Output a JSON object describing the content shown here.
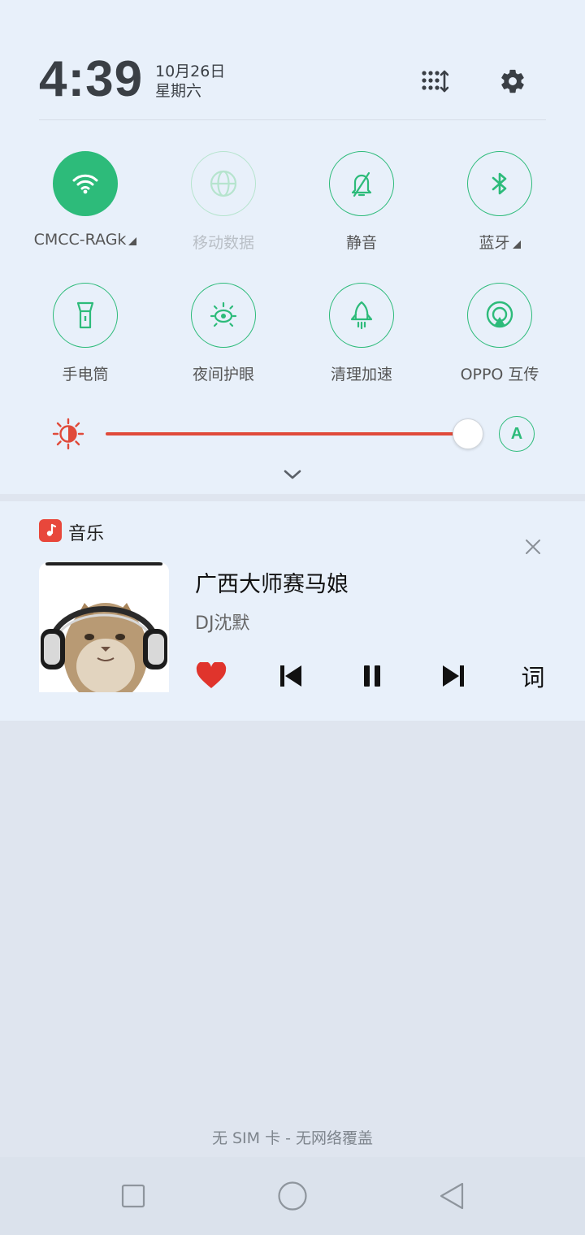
{
  "status": {
    "time": "4:39",
    "date": "10月26日",
    "weekday": "星期六"
  },
  "header_icons": {
    "edit": "grid-edit-icon",
    "settings": "gear-icon"
  },
  "quick_settings": {
    "row1": [
      {
        "label": "CMCC-RAGk",
        "icon": "wifi-icon",
        "state": "on",
        "expand": true
      },
      {
        "label": "移动数据",
        "icon": "globe-icon",
        "state": "disabled",
        "expand": false
      },
      {
        "label": "静音",
        "icon": "bell-off-icon",
        "state": "off",
        "expand": false
      },
      {
        "label": "蓝牙",
        "icon": "bluetooth-icon",
        "state": "off",
        "expand": true
      }
    ],
    "row2": [
      {
        "label": "手电筒",
        "icon": "flashlight-icon",
        "state": "off"
      },
      {
        "label": "夜间护眼",
        "icon": "eye-care-icon",
        "state": "off"
      },
      {
        "label": "清理加速",
        "icon": "rocket-icon",
        "state": "off"
      },
      {
        "label": "OPPO 互传",
        "icon": "share-icon",
        "state": "off"
      }
    ]
  },
  "brightness": {
    "level_percent": 100,
    "auto_label": "A"
  },
  "music": {
    "app_name": "音乐",
    "song_title": "广西大师赛马娘",
    "artist": "DJ沈默",
    "liked": true,
    "lyrics_label": "词"
  },
  "sim_status": "无 SIM 卡 - 无网络覆盖",
  "colors": {
    "accent": "#2dbb7a",
    "brightness": "#e04a3a",
    "like": "#e0342c"
  }
}
